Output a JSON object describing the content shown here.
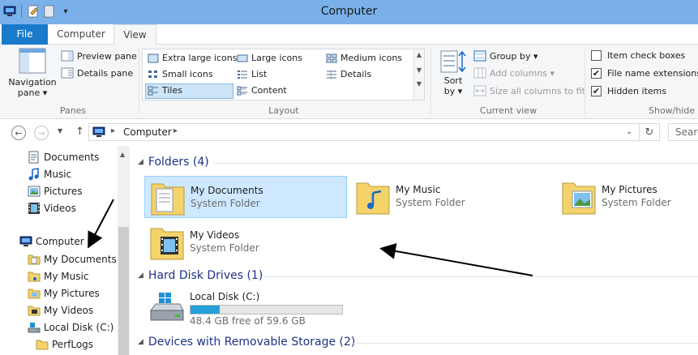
{
  "window": {
    "title": "Computer"
  },
  "ribbon": {
    "tabs": {
      "file": "File",
      "computer": "Computer",
      "view": "View"
    },
    "panes": {
      "label": "Panes",
      "navigation_pane": [
        "Navigation",
        "pane ▾"
      ],
      "preview_pane": "Preview pane",
      "details_pane": "Details pane"
    },
    "layout": {
      "label": "Layout",
      "options": {
        "extra_large": "Extra large icons",
        "large": "Large icons",
        "medium": "Medium icons",
        "small": "Small icons",
        "list": "List",
        "details": "Details",
        "tiles": "Tiles",
        "content": "Content"
      },
      "selected": "Tiles"
    },
    "current_view": {
      "label": "Current view",
      "sort_by": [
        "Sort",
        "by ▾"
      ],
      "group_by": "Group by ▾",
      "add_columns": "Add columns ▾",
      "size_all": "Size all columns to fit"
    },
    "show_hide": {
      "label": "Show/hide",
      "item_check_boxes": {
        "label": "Item check boxes",
        "checked": false
      },
      "file_name_extensions": {
        "label": "File name extensions",
        "checked": true
      },
      "hidden_items": {
        "label": "Hidden items",
        "checked": true
      }
    }
  },
  "address_bar": {
    "breadcrumb": "Computer",
    "search_placeholder": "Search Computer"
  },
  "nav_pane": {
    "items": [
      {
        "label": "Documents",
        "icon": "documents-icon"
      },
      {
        "label": "Music",
        "icon": "music-icon"
      },
      {
        "label": "Pictures",
        "icon": "pictures-icon"
      },
      {
        "label": "Videos",
        "icon": "videos-icon"
      },
      {
        "label": "Computer",
        "icon": "computer-icon"
      },
      {
        "label": "My Documents",
        "icon": "folder-documents-icon"
      },
      {
        "label": "My Music",
        "icon": "folder-music-icon"
      },
      {
        "label": "My Pictures",
        "icon": "folder-pictures-icon"
      },
      {
        "label": "My Videos",
        "icon": "folder-videos-icon"
      },
      {
        "label": "Local Disk (C:)",
        "icon": "drive-icon"
      },
      {
        "label": "PerfLogs",
        "icon": "folder-icon"
      }
    ]
  },
  "content": {
    "sections": {
      "folders": "Folders (4)",
      "hard_disks": "Hard Disk Drives (1)",
      "removable": "Devices with Removable Storage (2)"
    },
    "folders": [
      {
        "name": "My Documents",
        "type": "System Folder",
        "selected": true
      },
      {
        "name": "My Music",
        "type": "System Folder",
        "selected": false
      },
      {
        "name": "My Pictures",
        "type": "System Folder",
        "selected": false
      },
      {
        "name": "My Videos",
        "type": "System Folder",
        "selected": false
      }
    ],
    "drives": [
      {
        "name": "Local Disk (C:)",
        "space": "48.4 GB free of 59.6 GB",
        "used_fraction": 0.19
      }
    ]
  },
  "colors": {
    "titlebar": "#7ab1ea",
    "file_tab": "#1979ca",
    "selection": "#cde8ff",
    "section_header": "#1e3287",
    "progress_fill": "#26a0da"
  }
}
